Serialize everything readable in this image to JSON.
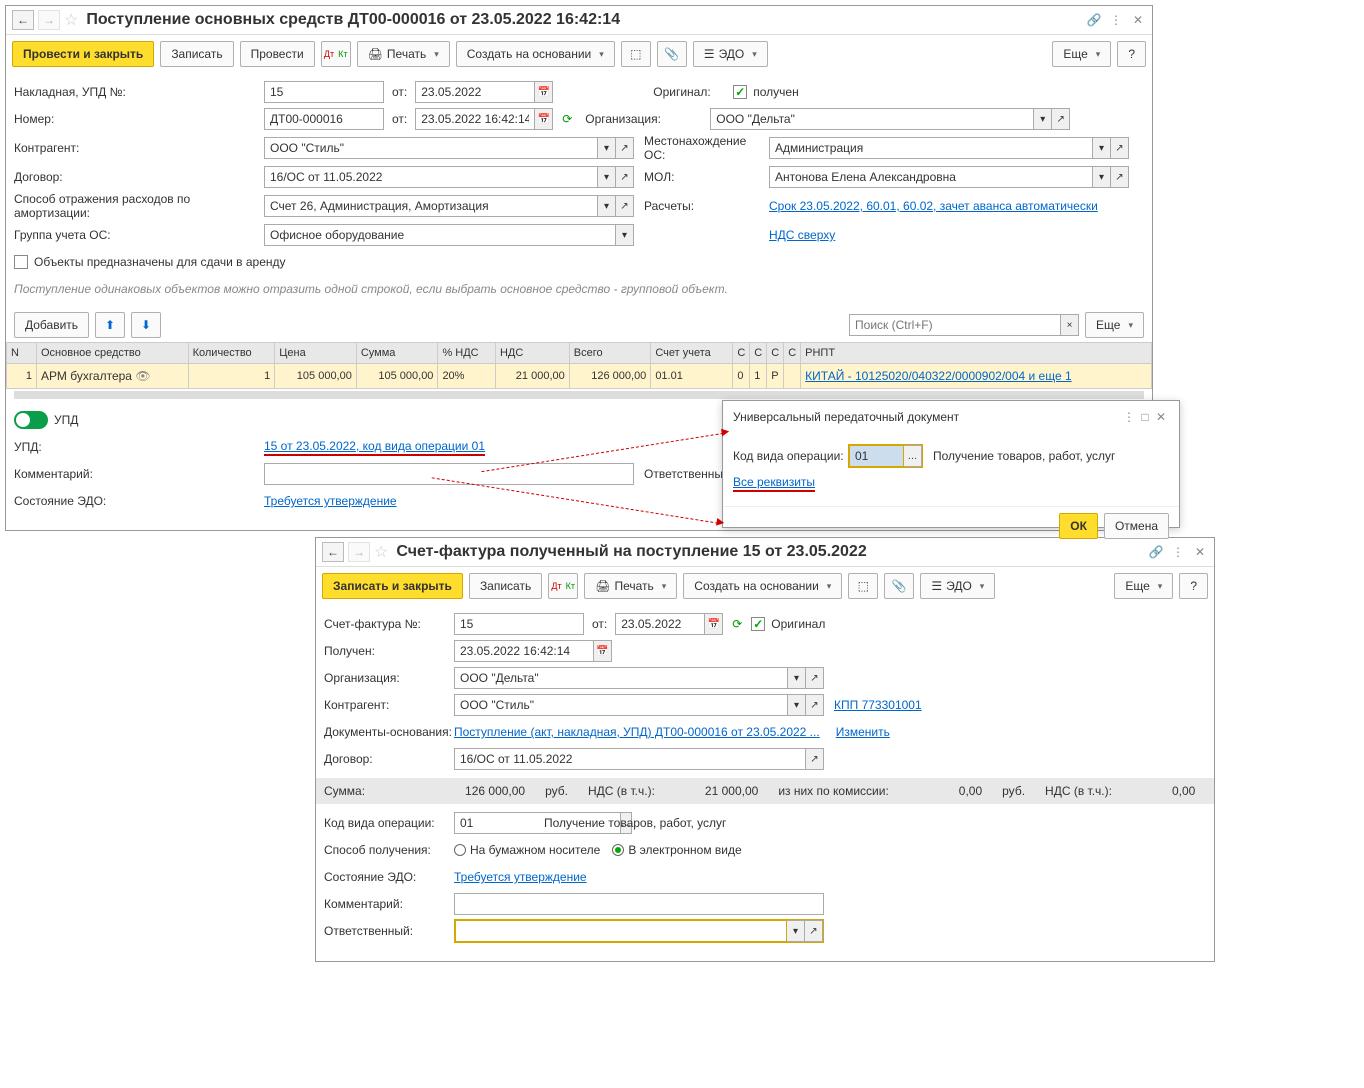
{
  "w1": {
    "title": "Поступление основных средств ДТ00-000016 от 23.05.2022 16:42:14",
    "btns": {
      "post_close": "Провести и закрыть",
      "write": "Записать",
      "post": "Провести",
      "print": "Печать",
      "create": "Создать на основании",
      "edo": "ЭДО",
      "more": "Еще",
      "help": "?"
    },
    "f": {
      "invoice_lbl": "Накладная, УПД №:",
      "invoice_no": "15",
      "from": "от:",
      "invoice_date": "23.05.2022",
      "orig_lbl": "Оригинал:",
      "received": "получен",
      "num_lbl": "Номер:",
      "num": "ДТ00-000016",
      "num_date": "23.05.2022 16:42:14",
      "org_lbl": "Организация:",
      "org": "ООО \"Дельта\"",
      "contr_lbl": "Контрагент:",
      "contr": "ООО \"Стиль\"",
      "loc_lbl": "Местонахождение ОС:",
      "loc": "Администрация",
      "dog_lbl": "Договор:",
      "dog": "16/ОС от 11.05.2022",
      "mol_lbl": "МОЛ:",
      "mol": "Антонова Елена Александровна",
      "amort_lbl": "Способ отражения расходов по амортизации:",
      "amort": "Счет 26, Администрация, Амортизация",
      "calc_lbl": "Расчеты:",
      "calc": "Срок 23.05.2022, 60.01, 60.02, зачет аванса автоматически",
      "group_lbl": "Группа учета ОС:",
      "group": "Офисное оборудование",
      "vat": "НДС сверху",
      "rent": "Объекты предназначены для сдачи в аренду",
      "hint": "Поступление одинаковых объектов можно отразить одной строкой, если выбрать основное средство - групповой объект.",
      "add": "Добавить",
      "search_ph": "Поиск (Ctrl+F)",
      "upd_tog": "УПД",
      "upd_lbl": "УПД:",
      "upd_link": "15 от 23.05.2022, код вида операции 01",
      "comm_lbl": "Комментарий:",
      "resp_lbl": "Ответственный",
      "edo_lbl": "Состояние ЭДО:",
      "edo_link": "Требуется утверждение"
    },
    "th": [
      "N",
      "Основное средство",
      "Количество",
      "Цена",
      "Сумма",
      "% НДС",
      "НДС",
      "Всего",
      "Счет учета",
      "С",
      "С",
      "С",
      "С",
      "РНПТ"
    ],
    "row": {
      "n": "1",
      "os": "АРМ бухгалтера",
      "qty": "1",
      "price": "105 000,00",
      "sum": "105 000,00",
      "vat_p": "20%",
      "vat": "21 000,00",
      "total": "126 000,00",
      "acc": "01.01",
      "c1": "0",
      "c2": "1",
      "c3": "Р",
      "rnpt": "КИТАЙ - 10125020/040322/0000902/004 и еще 1"
    }
  },
  "w2": {
    "title": "Универсальный передаточный документ",
    "code_lbl": "Код вида операции:",
    "code": "01",
    "desc": "Получение товаров, работ, услуг",
    "all": "Все реквизиты",
    "ok": "ОК",
    "cancel": "Отмена"
  },
  "w3": {
    "title": "Счет-фактура полученный на поступление 15 от 23.05.2022",
    "btns": {
      "save_close": "Записать и закрыть",
      "write": "Записать",
      "print": "Печать",
      "create": "Создать на основании",
      "edo": "ЭДО",
      "more": "Еще",
      "help": "?"
    },
    "f": {
      "sf_lbl": "Счет-фактура №:",
      "sf_no": "15",
      "from": "от:",
      "sf_date": "23.05.2022",
      "orig": "Оригинал",
      "rec_lbl": "Получен:",
      "rec": "23.05.2022 16:42:14",
      "org_lbl": "Организация:",
      "org": "ООО \"Дельта\"",
      "contr_lbl": "Контрагент:",
      "contr": "ООО \"Стиль\"",
      "kpp": "КПП 773301001",
      "docs_lbl": "Документы-основания:",
      "docs": "Поступление (акт, накладная, УПД) ДТ00-000016 от 23.05.2022 ...",
      "change": "Изменить",
      "dog_lbl": "Договор:",
      "dog": "16/ОС от 11.05.2022",
      "sum_lbl": "Сумма:",
      "sum": "126 000,00",
      "rub": "руб.",
      "vat_incl": "НДС (в т.ч.):",
      "vat": "21 000,00",
      "comm": "из них по комиссии:",
      "comm_v": "0,00",
      "vat2": "0,00",
      "code_lbl": "Код вида операции:",
      "code": "01",
      "code_desc": "Получение товаров, работ, услуг",
      "method_lbl": "Способ получения:",
      "paper": "На бумажном носителе",
      "electr": "В электронном виде",
      "edo_lbl": "Состояние ЭДО:",
      "edo_link": "Требуется утверждение",
      "comm_lbl": "Комментарий:",
      "resp_lbl": "Ответственный:"
    }
  }
}
